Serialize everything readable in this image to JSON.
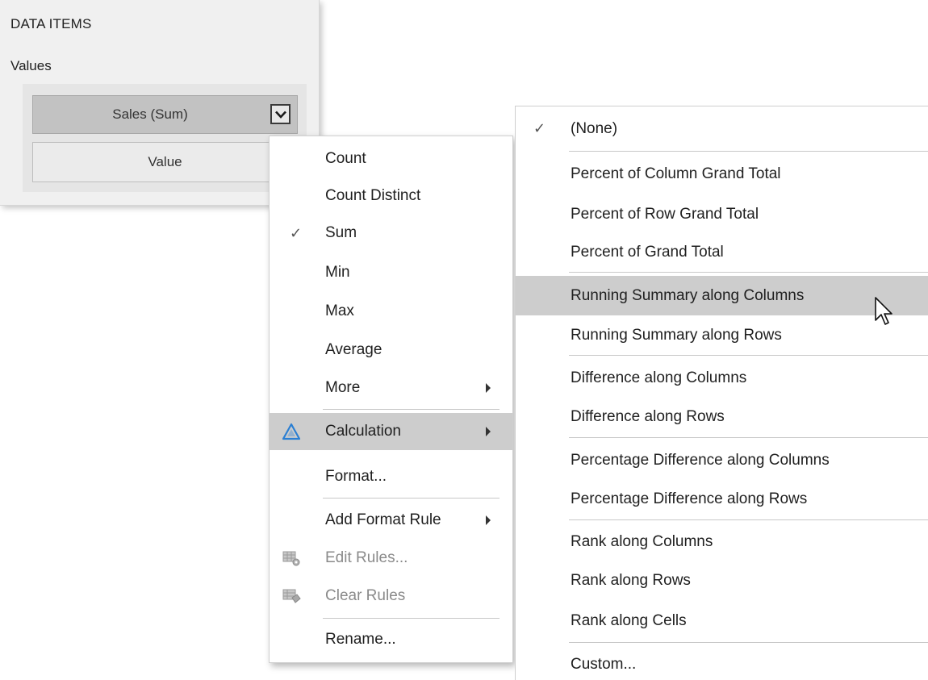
{
  "panel": {
    "title": "DATA ITEMS",
    "section": "Values",
    "items": [
      {
        "label": "Sales (Sum)",
        "selected": true
      },
      {
        "label": "Value",
        "selected": false
      }
    ]
  },
  "menu": {
    "count": "Count",
    "count_distinct": "Count Distinct",
    "sum": "Sum",
    "min": "Min",
    "max": "Max",
    "average": "Average",
    "more": "More",
    "calculation": "Calculation",
    "format": "Format...",
    "add_format_rule": "Add Format Rule",
    "edit_rules": "Edit Rules...",
    "clear_rules": "Clear Rules",
    "rename": "Rename...",
    "checked_item": "Sum",
    "highlighted_item": "Calculation",
    "check_glyph": "✓"
  },
  "submenu": {
    "none": "(None)",
    "pct_col_grand_total": "Percent of Column Grand Total",
    "pct_row_grand_total": "Percent of Row Grand Total",
    "pct_grand_total": "Percent of Grand Total",
    "running_cols": "Running Summary along Columns",
    "running_rows": "Running Summary along Rows",
    "diff_cols": "Difference along Columns",
    "diff_rows": "Difference along Rows",
    "pct_diff_cols": "Percentage Difference along Columns",
    "pct_diff_rows": "Percentage Difference along Rows",
    "rank_cols": "Rank along Columns",
    "rank_rows": "Rank along Rows",
    "rank_cells": "Rank along Cells",
    "custom": "Custom...",
    "checked_item": "(None)",
    "highlighted_item": "Running Summary along Columns",
    "check_glyph": "✓"
  },
  "colors": {
    "highlight": "#cdcdcd",
    "calculation_icon": "#2b7fd3",
    "disabled_text": "#8a8a8a"
  },
  "icons": {
    "dropdown": "chevron-down-icon",
    "calculation": "triangle-delta-icon",
    "edit_rules": "grid-gear-icon",
    "clear_rules": "grid-eraser-icon",
    "cursor": "mouse-pointer-icon"
  }
}
